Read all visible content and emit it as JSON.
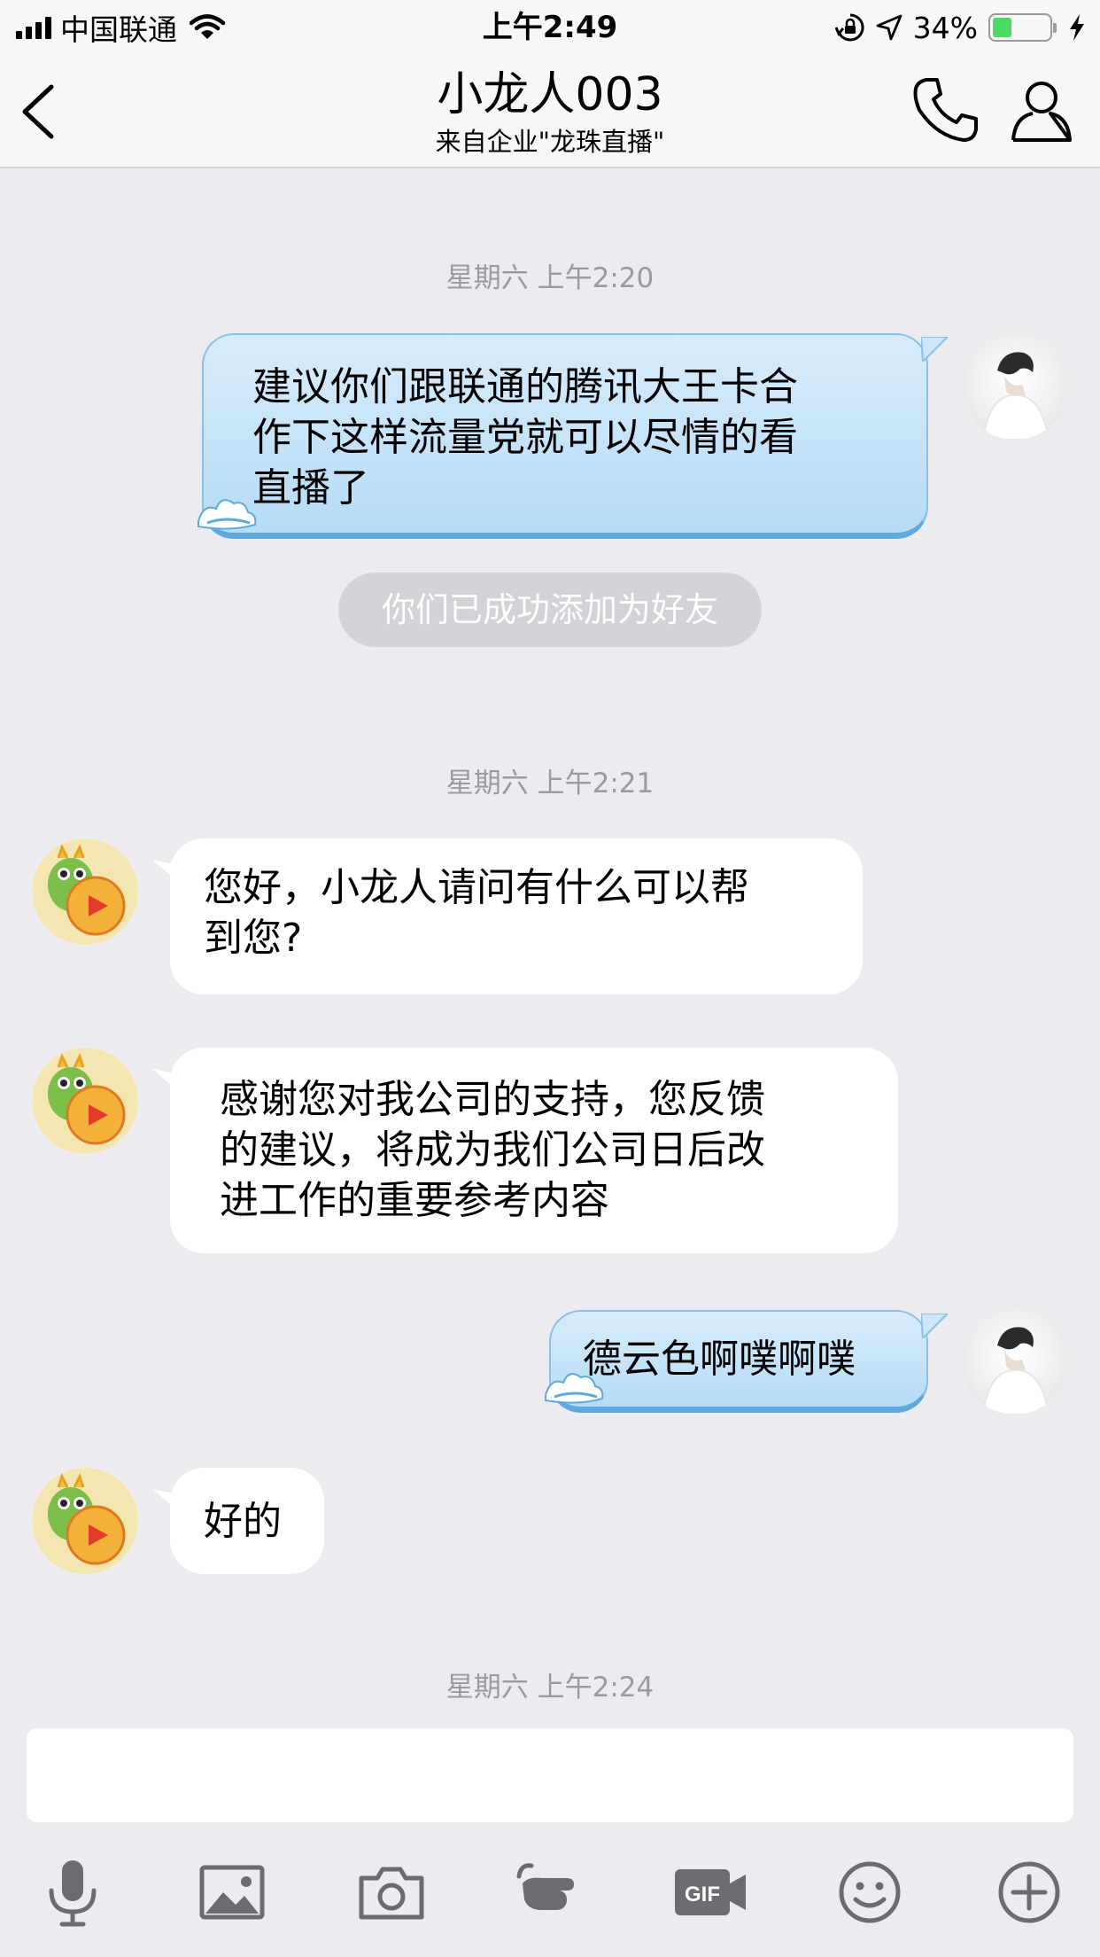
{
  "status_bar": {
    "carrier": "中国联通",
    "time": "上午2:49",
    "battery_percent": "34%",
    "battery_level": 0.34,
    "icons": [
      "signal-icon",
      "wifi-icon",
      "orientation-lock-icon",
      "location-arrow-icon",
      "battery-icon",
      "charging-bolt-icon"
    ]
  },
  "nav": {
    "title": "小龙人003",
    "subtitle": "来自企业\"龙珠直播\"",
    "icons": [
      "back-chevron-icon",
      "phone-icon",
      "person-icon"
    ]
  },
  "chat": {
    "timestamps": [
      "星期六 上午2:20",
      "星期六 上午2:21",
      "星期六 上午2:24"
    ],
    "system_note": "你们已成功添加为好友",
    "messages": [
      {
        "sender": "me",
        "lines": [
          "建议你们跟联通的腾讯大王卡合",
          "作下这样流量党就可以尽情的看",
          "直播了"
        ]
      },
      {
        "sender": "bot",
        "lines": [
          "您好，小龙人请问有什么可以帮",
          "到您?"
        ]
      },
      {
        "sender": "bot",
        "lines": [
          "感谢您对我公司的支持，您反馈",
          "的建议，将成为我们公司日后改",
          "进工作的重要参考内容"
        ]
      },
      {
        "sender": "me",
        "lines": [
          "德云色啊噗啊噗"
        ]
      },
      {
        "sender": "bot",
        "lines": [
          "好的"
        ]
      }
    ]
  },
  "input": {
    "value": ""
  },
  "toolbar": {
    "icons": [
      "microphone-icon",
      "image-icon",
      "camera-icon",
      "pointing-hand-icon",
      "gif-icon",
      "emoji-icon",
      "plus-icon"
    ],
    "gif_label": "GIF"
  },
  "colors": {
    "outgoing_bubble": "#b6dcf6",
    "outgoing_border": "#5ea9dd",
    "incoming_bubble": "#ffffff",
    "background": "#ebebf0",
    "timestamp_text": "#9b9b9f",
    "battery_green": "#4cd964"
  }
}
